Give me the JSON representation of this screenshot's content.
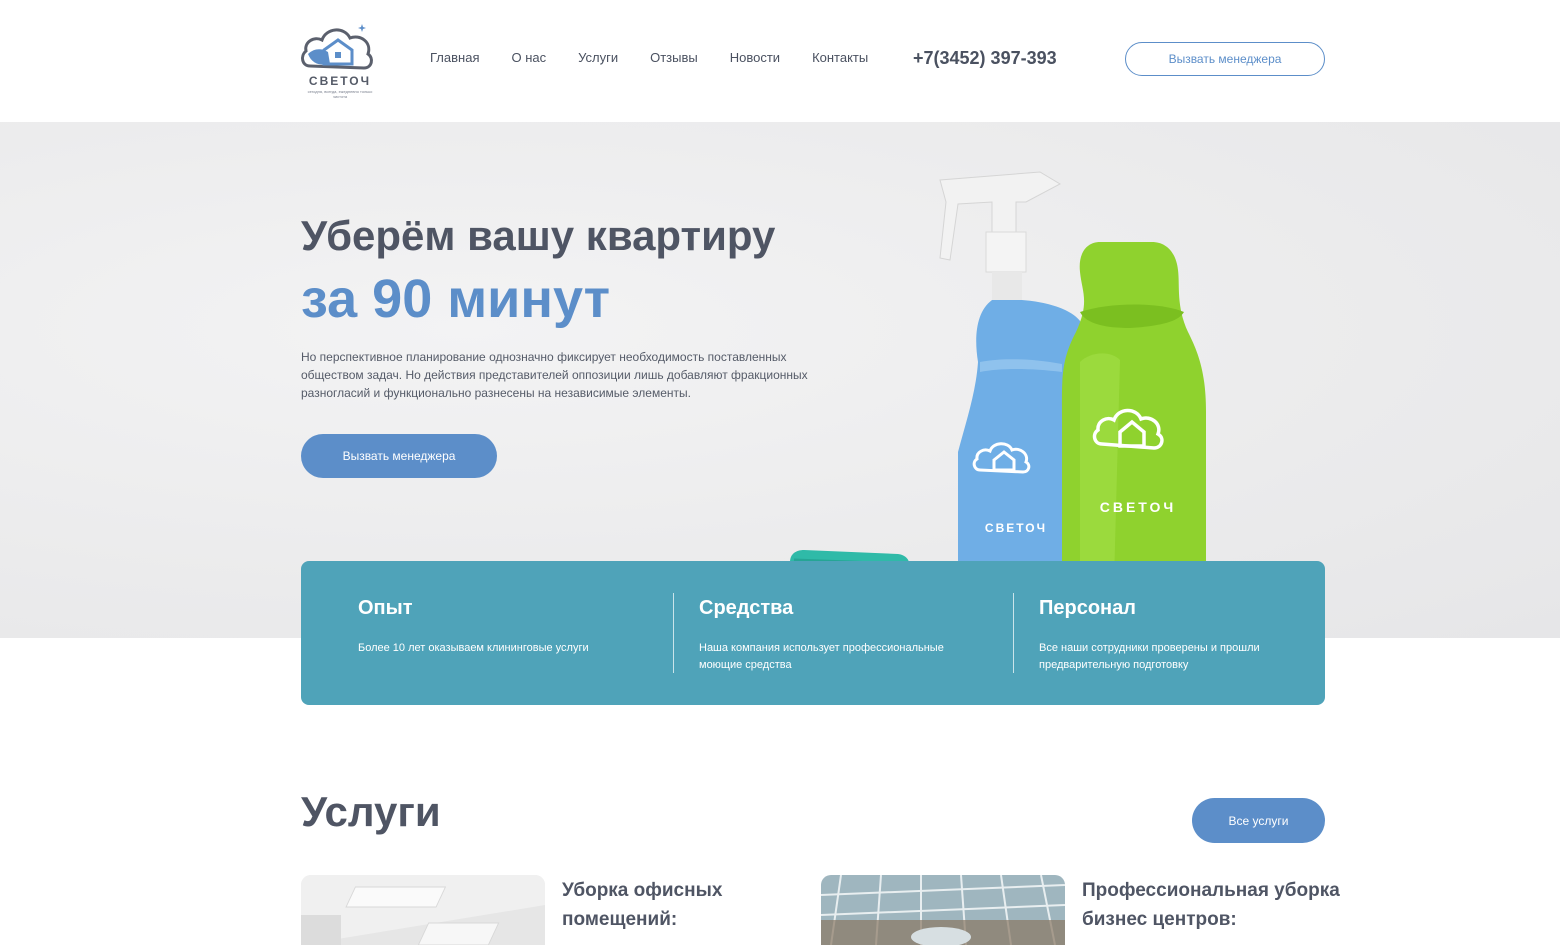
{
  "header": {
    "logo_word": "СВЕТОЧ",
    "logo_tagline": "сегодня, всегда, ежедневно только чистота",
    "nav": [
      "Главная",
      "О нас",
      "Услуги",
      "Отзывы",
      "Новости",
      "Контакты"
    ],
    "phone": "+7(3452) 397-393",
    "cta": "Вызвать менеджера"
  },
  "hero": {
    "title_line1": "Уберём вашу квартиру",
    "title_line2": "за 90 минут",
    "description": "Но перспективное планирование однозначно фиксирует необходимость поставленных обществом задач. Но действия представителей оппозиции лишь добавляют фракционных разногласий и функционально разнесены на независимые элементы.",
    "cta": "Вызвать менеджера",
    "bottle_label": "СВЕТОЧ"
  },
  "features": [
    {
      "title": "Опыт",
      "text": "Более 10 лет оказываем клининговые услуги"
    },
    {
      "title": "Средства",
      "text": "Наша компания использует профессиональные моющие средства"
    },
    {
      "title": "Персонал",
      "text": "Все наши сотрудники проверены и прошли предварительную подготовку"
    }
  ],
  "services": {
    "title": "Услуги",
    "all_button": "Все услуги",
    "cards": [
      {
        "title": "Уборка офисных помещений:"
      },
      {
        "title": "Профессиональная уборка бизнес центров:"
      }
    ]
  },
  "colors": {
    "accent": "#5c8ec9",
    "teal": "#4fa3b9",
    "text": "#4f5564"
  }
}
